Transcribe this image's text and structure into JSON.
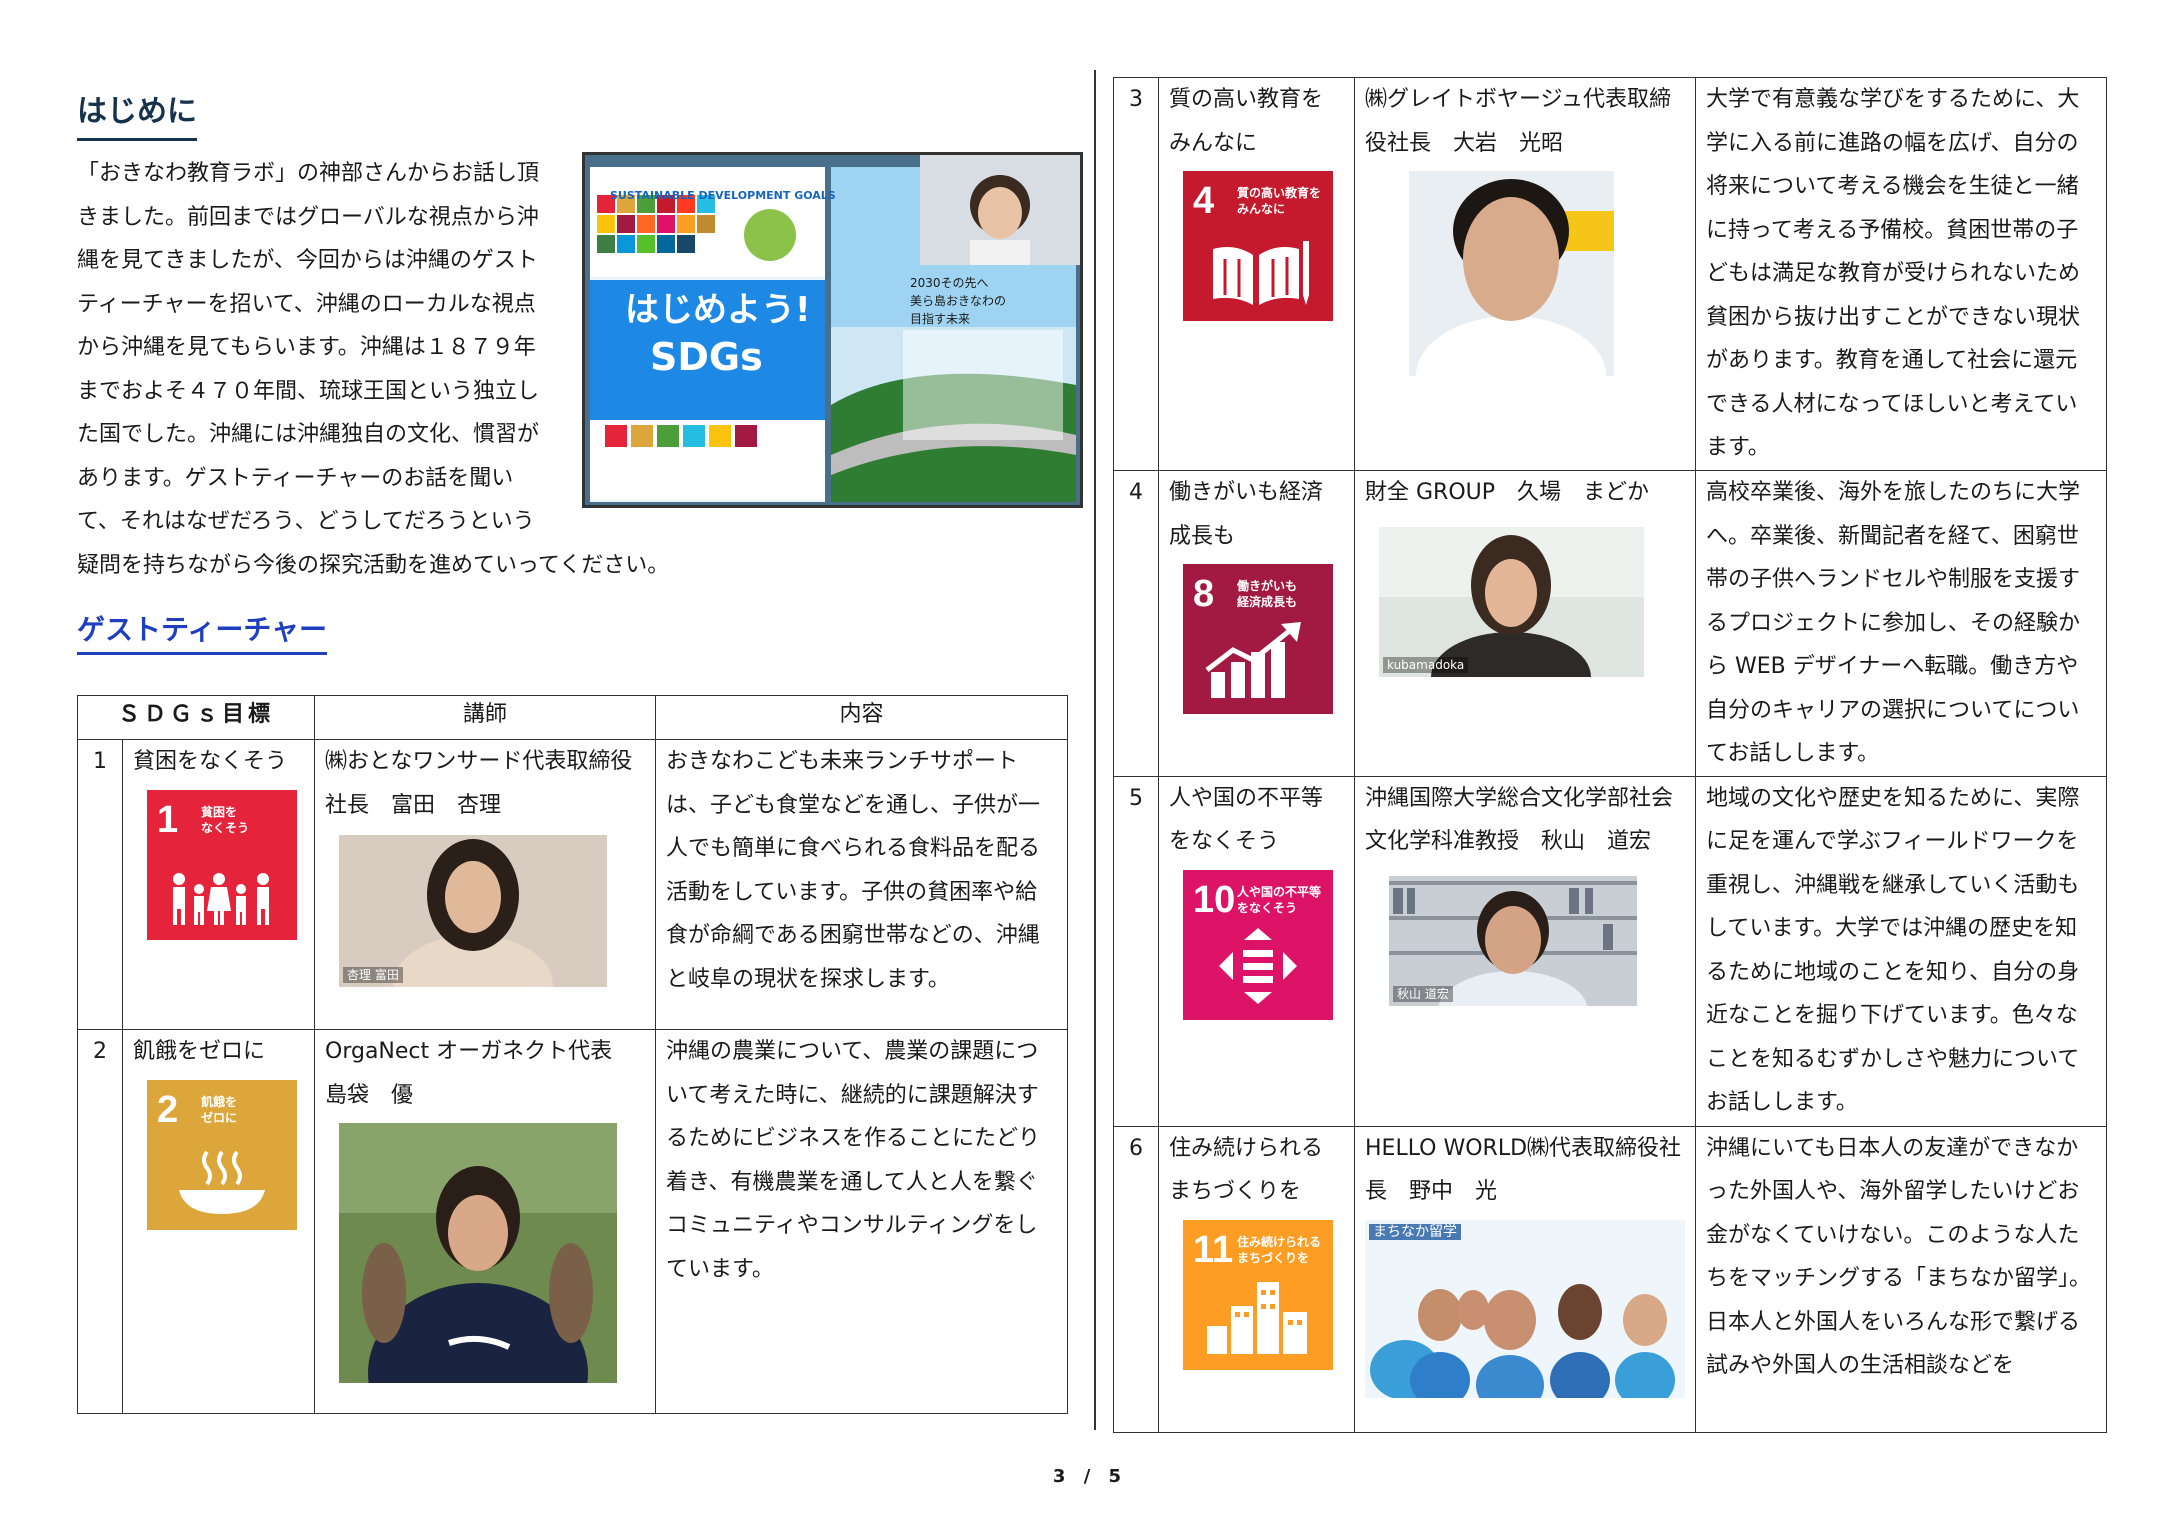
{
  "intro": {
    "heading": "はじめに",
    "paragraph": "「おきなわ教育ラボ」の神部さんからお話し頂きました。前回まではグローバルな視点から沖縄を見てきましたが、今回からは沖縄のゲストティーチャーを招いて、沖縄のローカルな視点から沖縄を見てもらいます。沖縄は１８７９年までおよそ４７０年間、琉球王国という独立した国でした。沖縄には沖縄独自の文化、慣習があります。ゲストティーチャーのお話を聞いて、それはなぜだろう、どうしてだろうという疑問を持ちながら今後の探究活動を進めていってください。",
    "poster": {
      "goals_label": "SUSTAINABLE DEVELOPMENT GOALS",
      "title_line1": "はじめよう!",
      "title_line2": "SDGs",
      "right_caption_1": "2030その先へ",
      "right_caption_2": "美ら島おきなわの",
      "right_caption_3": "目指す未来"
    }
  },
  "guest_heading": "ゲストティーチャー",
  "table_headers": {
    "goal": "ＳＤＧｓ目標",
    "teacher": "講師",
    "content": "内容"
  },
  "rows": [
    {
      "num": "1",
      "goal": "貧困をなくそう",
      "tile_num": "1",
      "tile_label": "貧困を\nなくそう",
      "tile_color": "#e5243b",
      "teacher": "㈱おとなワンサード代表取締役社長　富田　杏理",
      "photo_caption": "杏理 富田",
      "content": "おきなわこども未来ランチサポートは、子ども食堂などを通し、子供が一人でも簡単に食べられる食料品を配る活動をしています。子供の貧困率や給食が命綱である困窮世帯などの、沖縄と岐阜の現状を探求します。"
    },
    {
      "num": "2",
      "goal": "飢餓をゼロに",
      "tile_num": "2",
      "tile_label": "飢餓を\nゼロに",
      "tile_color": "#dda63a",
      "teacher": "OrgaNect オーガネクト代表　島袋　優",
      "photo_caption": "",
      "content": "沖縄の農業について、農業の課題について考えた時に、継続的に課題解決するためにビジネスを作ることにたどり着き、有機農業を通して人と人を繋ぐコミュニティやコンサルティングをしています。"
    },
    {
      "num": "3",
      "goal": "質の高い教育をみんなに",
      "tile_num": "4",
      "tile_label": "質の高い教育を\nみんなに",
      "tile_color": "#c5192d",
      "teacher": "㈱グレイトボヤージュ代表取締役社長　大岩　光昭",
      "photo_caption": "",
      "content": "大学で有意義な学びをするために、大学に入る前に進路の幅を広げ、自分の将来について考える機会を生徒と一緒に持って考える予備校。貧困世帯の子どもは満足な教育が受けられないため貧困から抜け出すことができない現状があります。教育を通して社会に還元できる人材になってほしいと考えています。"
    },
    {
      "num": "4",
      "goal": "働きがいも経済成長も",
      "tile_num": "8",
      "tile_label": "働きがいも\n経済成長も",
      "tile_color": "#a21942",
      "teacher": "財全 GROUP　久場　まどか",
      "photo_caption": "kubamadoka",
      "content": "高校卒業後、海外を旅したのちに大学へ。卒業後、新聞記者を経て、困窮世帯の子供へランドセルや制服を支援するプロジェクトに参加し、その経験から WEB デザイナーへ転職。働き方や自分のキャリアの選択についてについてお話しします。"
    },
    {
      "num": "5",
      "goal": "人や国の不平等をなくそう",
      "tile_num": "10",
      "tile_label": "人や国の不平等\nをなくそう",
      "tile_color": "#dd1367",
      "teacher": "沖縄国際大学総合文化学部社会文化学科准教授　秋山　道宏",
      "photo_caption": "秋山 道宏",
      "content": "地域の文化や歴史を知るために、実際に足を運んで学ぶフィールドワークを重視し、沖縄戦を継承していく活動もしています。大学では沖縄の歴史を知るために地域のことを知り、自分の身近なことを掘り下げています。色々なことを知るむずかしさや魅力についてお話しします。"
    },
    {
      "num": "6",
      "goal": "住み続けられるまちづくりを",
      "tile_num": "11",
      "tile_label": "住み続けられる\nまちづくりを",
      "tile_color": "#fd9d24",
      "teacher": "HELLO WORLD㈱代表取締役社長　野中　光",
      "photo_caption": "まちなか留学",
      "content": "沖縄にいても日本人の友達ができなかった外国人や、海外留学したいけどお金がなくていけない。このような人たちをマッチングする「まちなか留学」。日本人と外国人をいろんな形で繋げる試みや外国人の生活相談などを"
    }
  ],
  "page_number": "3 / 5"
}
